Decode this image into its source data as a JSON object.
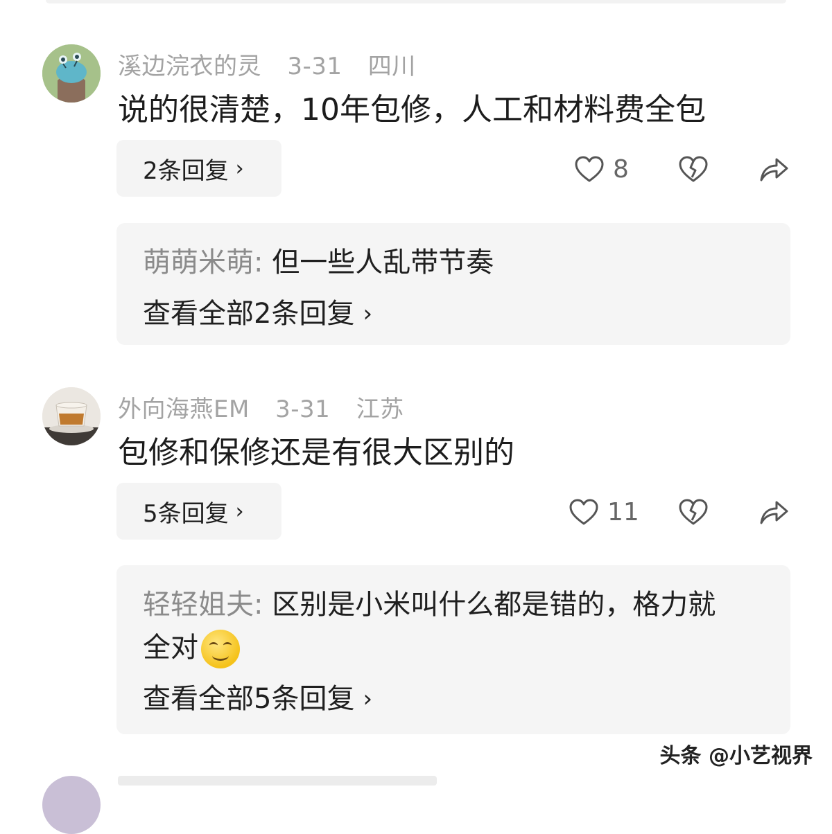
{
  "comments": [
    {
      "author": "溪边浣衣的灵",
      "date": "3-31",
      "location": "四川",
      "text": "说的很清楚，10年包修，人工和材料费全包",
      "replies_label": "2条回复",
      "likes": "8",
      "reply_preview": {
        "user": "萌萌米萌:",
        "text": " 但一些人乱带节奏",
        "view_all": "查看全部2条回复"
      }
    },
    {
      "author": "外向海燕EM",
      "date": "3-31",
      "location": "江苏",
      "text": "包修和保修还是有很大区别的",
      "replies_label": "5条回复",
      "likes": "11",
      "reply_preview": {
        "user": "轻轻姐夫:",
        "text": " 区别是小米叫什么都是错的，格力就",
        "text_line2": "全对",
        "view_all": "查看全部5条回复"
      }
    }
  ],
  "watermark": "头条 @小艺视界",
  "icons": {
    "like": "heart-outline-icon",
    "dislike": "broken-heart-icon",
    "share": "share-arrow-icon",
    "chevron": "chevron-right-icon"
  }
}
